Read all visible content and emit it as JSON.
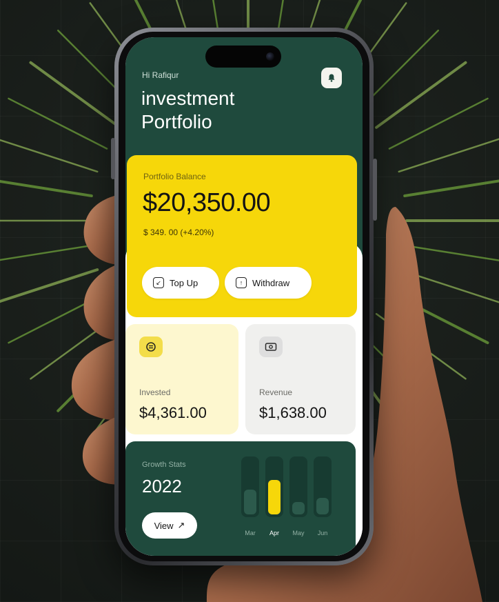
{
  "app": {
    "greeting": "Hi Rafiqur",
    "title": "investment Portfolio",
    "notification_icon": "bell-icon"
  },
  "balance": {
    "label": "Portfolio Balance",
    "value": "$20,350.00",
    "change": "$ 349. 00 (+4.20%)",
    "topup_label": "Top Up",
    "topup_icon": "topup-icon",
    "withdraw_label": "Withdraw",
    "withdraw_icon": "withdraw-icon"
  },
  "stats": [
    {
      "label": "Invested",
      "value": "$4,361.00",
      "icon": "coins-icon"
    },
    {
      "label": "Revenue",
      "value": "$1,638.00",
      "icon": "cash-icon"
    }
  ],
  "growth": {
    "label": "Growth Stats",
    "year": "2022",
    "view_label": "View",
    "view_icon": "arrow-up-right-icon",
    "months": [
      "Mar",
      "Apr",
      "May",
      "Jun"
    ],
    "levels": [
      0.45,
      0.62,
      0.22,
      0.3
    ],
    "active_index": 1
  },
  "colors": {
    "primary_green": "#1f4a3d",
    "accent_yellow": "#f6d70a",
    "invested_bg": "#fdf7cf",
    "revenue_bg": "#f0f0ee"
  }
}
